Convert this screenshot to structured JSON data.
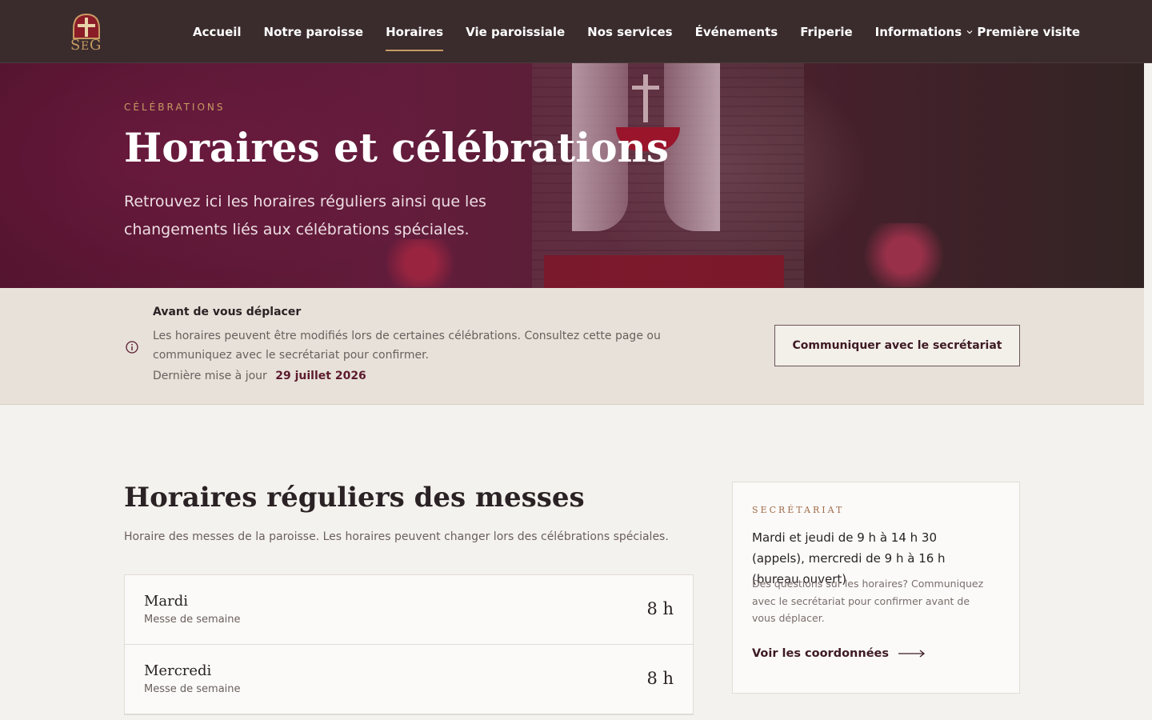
{
  "nav": {
    "logo_alt": "SEG",
    "items": [
      {
        "label": "Accueil"
      },
      {
        "label": "Notre paroisse"
      },
      {
        "label": "Horaires"
      },
      {
        "label": "Vie paroissiale"
      },
      {
        "label": "Nos services"
      },
      {
        "label": "Événements"
      },
      {
        "label": "Friperie"
      },
      {
        "label": "Informations"
      }
    ],
    "active": "Horaires",
    "cta": "Première visite"
  },
  "hero": {
    "eyebrow": "CÉLÉBRATIONS",
    "title": "Horaires et célébrations",
    "subtitle": "Retrouvez ici les horaires réguliers ainsi que les changements liés aux célébrations spéciales."
  },
  "notice": {
    "icon": "info-icon",
    "title": "Avant de vous déplacer",
    "text": "Les horaires peuvent être modifiés lors de certaines célébrations. Consultez cette page ou communiquez avec le secrétariat pour confirmer.",
    "updated_label": "Dernière mise à jour",
    "updated_date": "29 juillet 2026",
    "button": "Communiquer avec le secrétariat"
  },
  "schedule": {
    "title": "Horaires réguliers des messes",
    "description": "Horaire des messes de la paroisse. Les horaires peuvent changer lors des célébrations spéciales.",
    "rows": [
      {
        "day": "Mardi",
        "type": "Messe de semaine",
        "time": "8 h"
      },
      {
        "day": "Mercredi",
        "type": "Messe de semaine",
        "time": "8 h"
      }
    ]
  },
  "secretariat": {
    "eyebrow": "SECRÉTARIAT",
    "hours": "Mardi et jeudi de 9 h à 14 h 30 (appels), mercredi de 9 h à 16 h (bureau ouvert)",
    "note": "Des questions sur les horaires? Communiquez avec le secrétariat pour confirmer avant de vous déplacer.",
    "link": "Voir les coordonnées"
  },
  "colors": {
    "nav_bg": "#3a2c2d",
    "accent_gold": "#c79b63",
    "burgundy": "#5c1c2e",
    "notice_bg": "#e7e1d9",
    "page_bg": "#f4f2ee"
  }
}
